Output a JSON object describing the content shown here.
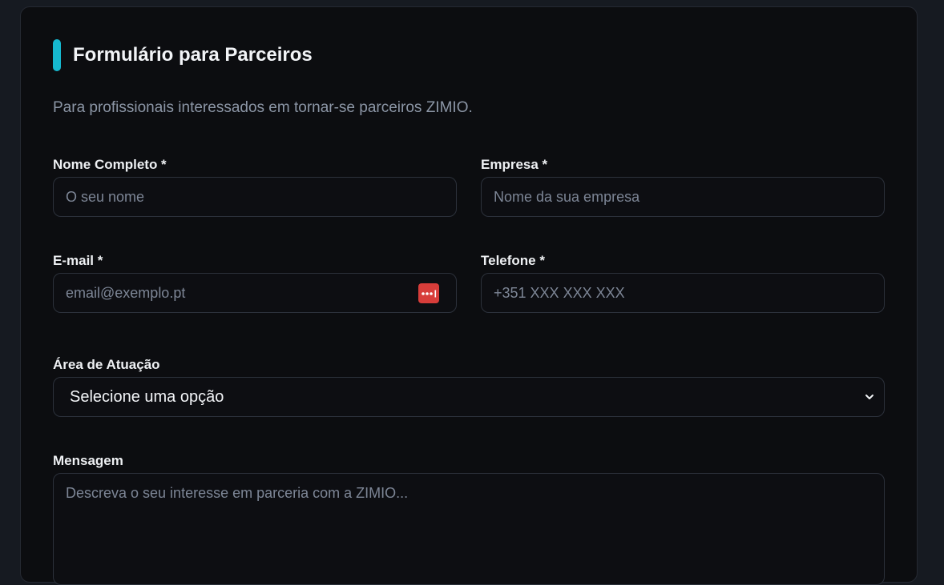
{
  "form": {
    "title": "Formulário para Parceiros",
    "subtitle": "Para profissionais interessados em tornar-se parceiros ZIMIO.",
    "accent_color": "#16b8cf",
    "fields": {
      "name": {
        "label": "Nome Completo *",
        "placeholder": "O seu nome"
      },
      "company": {
        "label": "Empresa *",
        "placeholder": "Nome da sua empresa"
      },
      "email": {
        "label": "E-mail *",
        "placeholder": "email@exemplo.pt",
        "autofill_icon": "password-manager-icon"
      },
      "phone": {
        "label": "Telefone *",
        "placeholder": "+351 XXX XXX XXX"
      },
      "area": {
        "label": "Área de Atuação",
        "selected": "Selecione uma opção"
      },
      "message": {
        "label": "Mensagem",
        "placeholder": "Descreva o seu interesse em parceria com a ZIMIO..."
      }
    }
  }
}
